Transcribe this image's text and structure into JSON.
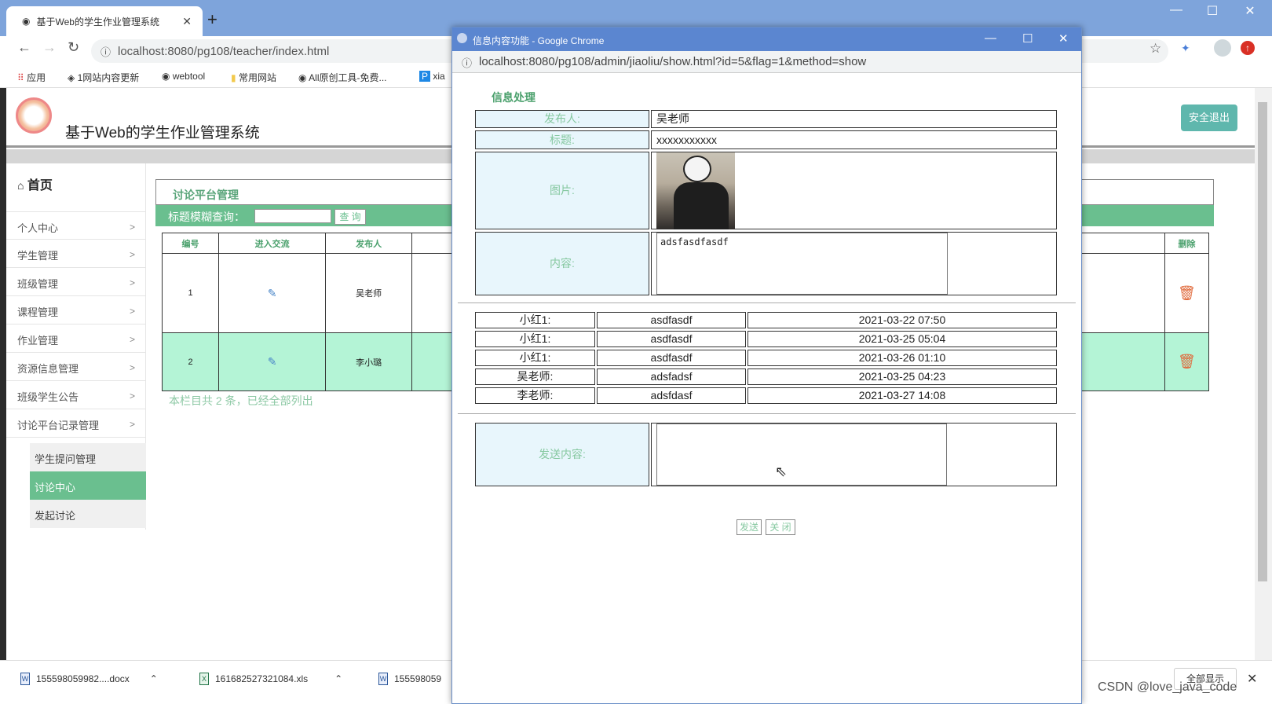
{
  "browser": {
    "tab_title": "基于Web的学生作业管理系统",
    "url": "localhost:8080/pg108/teacher/index.html",
    "bookmarks": [
      "应用",
      "1网站内容更新",
      "webtool",
      "常用网站",
      "All原创工具-免费...",
      "xia"
    ]
  },
  "page": {
    "site_title": "基于Web的学生作业管理系统",
    "logout_label": "安全退出",
    "home_label": "首页",
    "menu": [
      "个人中心",
      "学生管理",
      "班级管理",
      "课程管理",
      "作业管理",
      "资源信息管理",
      "班级学生公告",
      "讨论平台记录管理"
    ],
    "submenu": [
      "学生提问管理",
      "讨论中心",
      "发起讨论"
    ],
    "active_submenu": "讨论中心",
    "panel_title": "讨论平台管理",
    "search_label": "标题模糊查询：",
    "search_button": "查 询",
    "table": {
      "headers": [
        "编号",
        "进入交流",
        "发布人",
        "删除"
      ],
      "rows": [
        {
          "id": "1",
          "publisher": "吴老师"
        },
        {
          "id": "2",
          "publisher": "李小璐"
        }
      ]
    },
    "summary": "本栏目共 2 条，已经全部列出"
  },
  "popup": {
    "window_title": "信息内容功能 - Google Chrome",
    "url": "localhost:8080/pg108/admin/jiaoliu/show.html?id=5&flag=1&method=show",
    "heading": "信息处理",
    "fields": {
      "publisher_label": "发布人:",
      "publisher_value": "吴老师",
      "title_label": "标题:",
      "title_value": "xxxxxxxxxxx",
      "image_label": "图片:",
      "content_label": "内容:",
      "content_value": "adsfasdfasdf"
    },
    "messages": [
      {
        "user": "小红1:",
        "text": "asdfasdf",
        "time": "2021-03-22 07:50"
      },
      {
        "user": "小红1:",
        "text": "asdfasdf",
        "time": "2021-03-25 05:04"
      },
      {
        "user": "小红1:",
        "text": "asdfasdf",
        "time": "2021-03-26 01:10"
      },
      {
        "user": "吴老师:",
        "text": "adsfadsf",
        "time": "2021-03-25 04:23"
      },
      {
        "user": "李老师:",
        "text": "adsfdasf",
        "time": "2021-03-27 14:08"
      }
    ],
    "send_label": "发送内容:",
    "send_button": "发送",
    "close_button": "关 闭"
  },
  "downloads": {
    "items": [
      "155598059982....docx",
      "161682527321084.xls",
      "155598059"
    ],
    "show_all": "全部显示"
  },
  "watermark": "CSDN @love_java_code"
}
